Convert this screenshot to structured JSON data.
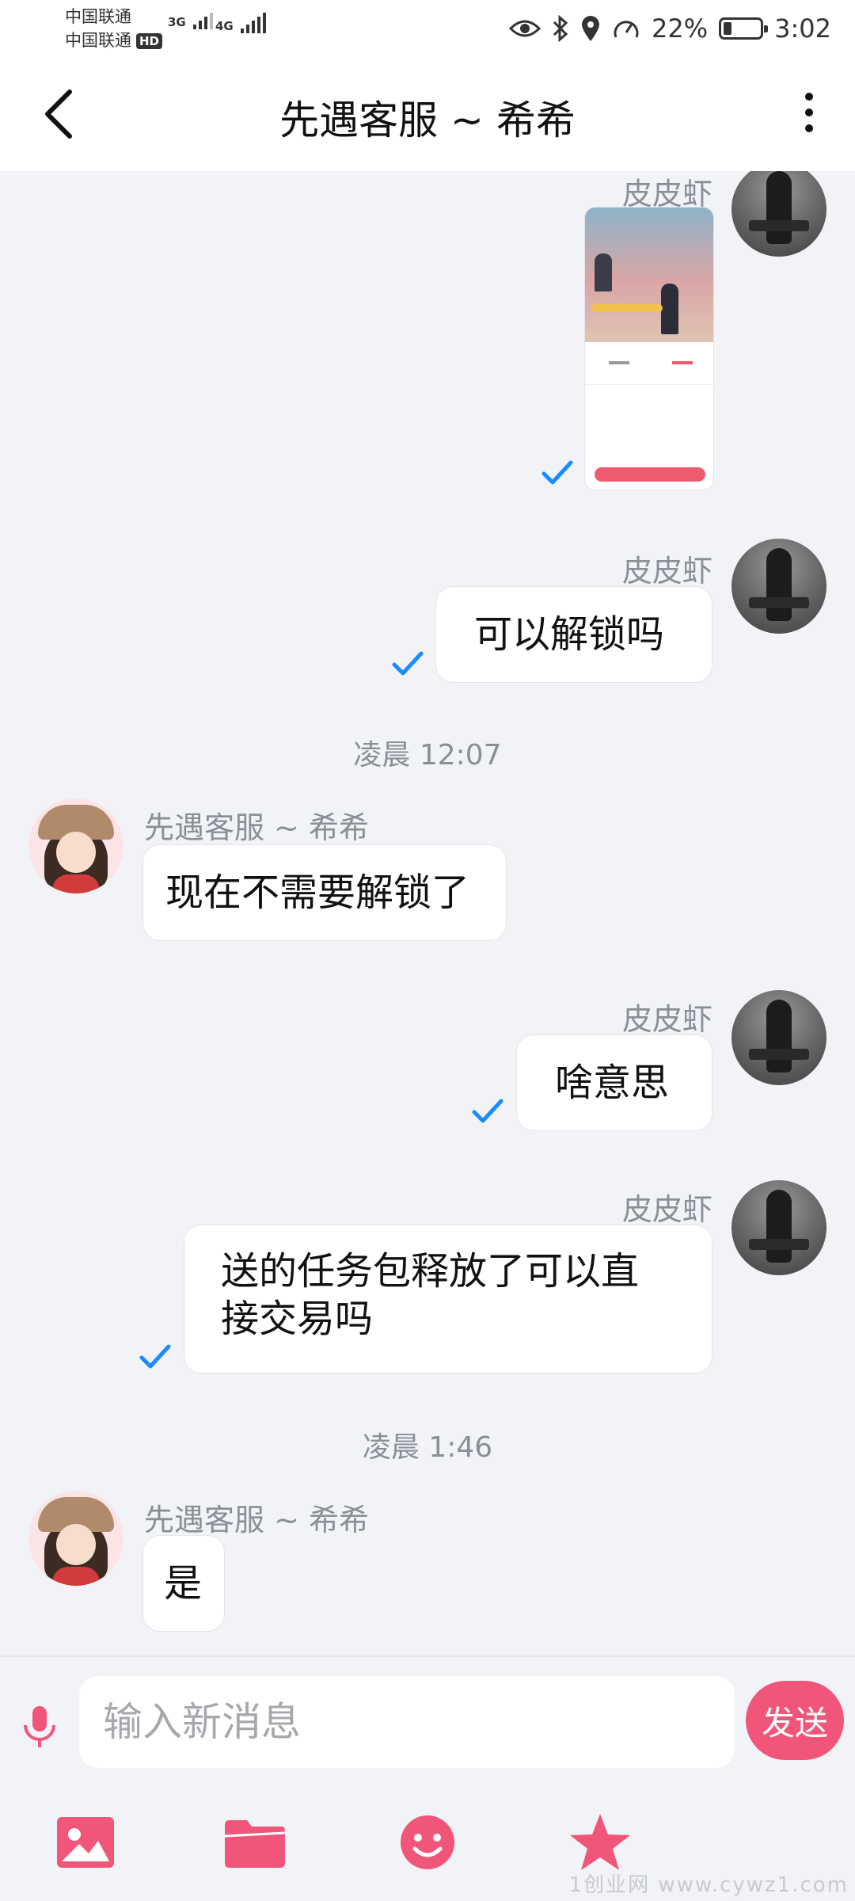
{
  "status_bar": {
    "carrier1": "中国联通",
    "carrier2": "中国联通",
    "hd": "HD",
    "net1": "3G",
    "net2": "4G",
    "battery_percent": "22%",
    "battery_level": 0.22,
    "time": "3:02"
  },
  "header": {
    "title": "先遇客服 ~ 希希"
  },
  "messages": {
    "m1_sender": "皮皮虾",
    "m2_sender": "皮皮虾",
    "m2_text": "可以解锁吗",
    "t1": "凌晨 12:07",
    "m3_sender": "先遇客服 ~ 希希",
    "m3_text": "现在不需要解锁了",
    "m4_sender": "皮皮虾",
    "m4_text": "啥意思",
    "m5_sender": "皮皮虾",
    "m5_line1": "送的任务包释放了可以直",
    "m5_line2": "接交易吗",
    "t2": "凌晨 1:46",
    "m6_sender": "先遇客服 ~ 希希",
    "m6_text": "是"
  },
  "input": {
    "placeholder": "输入新消息",
    "send_label": "发送"
  },
  "toolbar": {
    "icons": [
      "image-icon",
      "folder-icon",
      "emoji-icon",
      "star-icon"
    ]
  },
  "watermark": "1创业网 www.cywz1.com",
  "colors": {
    "accent": "#f2557a",
    "check": "#1a8cff",
    "background": "#f2f3f7"
  }
}
